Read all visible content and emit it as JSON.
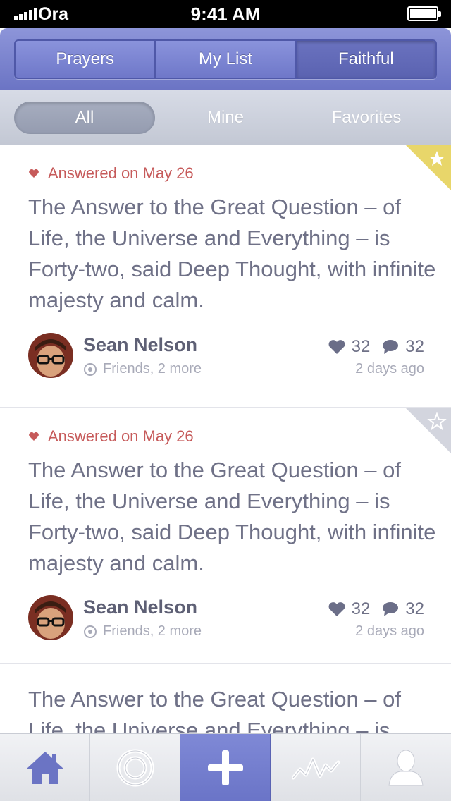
{
  "status_bar": {
    "carrier": "Ora",
    "time": "9:41 AM",
    "battery_level": 0.92
  },
  "top_tabs": [
    {
      "label": "Prayers",
      "active": false
    },
    {
      "label": "My List",
      "active": false
    },
    {
      "label": "Faithful",
      "active": true
    }
  ],
  "filters": [
    {
      "label": "All",
      "active": true
    },
    {
      "label": "Mine",
      "active": false
    },
    {
      "label": "Favorites",
      "active": false
    }
  ],
  "posts": [
    {
      "status": "Answered on May 26",
      "text": "The Answer to the Great Question – of Life, the Universe and Everything – is Forty-two, said Deep Thought, with infinite majesty and calm.",
      "author": "Sean Nelson",
      "audience": "Friends, 2 more",
      "likes": "32",
      "comments": "32",
      "time": "2 days ago",
      "favorite": true
    },
    {
      "status": "Answered on May 26",
      "text": "The Answer to the Great Question – of Life, the Universe and Everything – is Forty-two, said Deep Thought, with infinite majesty and calm.",
      "author": "Sean Nelson",
      "audience": "Friends, 2 more",
      "likes": "32",
      "comments": "32",
      "time": "2 days ago",
      "favorite": false
    },
    {
      "text": "The Answer to the Great Question – of Life, the Universe and Everything – is Forty-two, said Deep Thought, with infinite majesty and calm."
    }
  ],
  "tab_bar": [
    {
      "icon": "home-icon"
    },
    {
      "icon": "target-icon"
    },
    {
      "icon": "plus-icon"
    },
    {
      "icon": "activity-icon"
    },
    {
      "icon": "profile-icon"
    }
  ],
  "colors": {
    "brand": "#6b74c4",
    "answered": "#c65a5a",
    "favorite": "#e8d66a",
    "unfavorite": "#d3d5de"
  }
}
